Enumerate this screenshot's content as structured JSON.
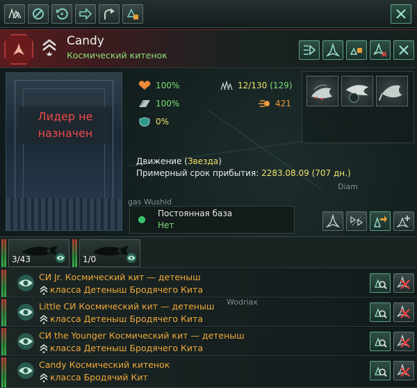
{
  "toolbar": {
    "buttons": [
      {
        "icon": "fleet-formation-icon"
      },
      {
        "icon": "stop-icon"
      },
      {
        "icon": "return-icon"
      },
      {
        "icon": "move-arrow-icon"
      },
      {
        "icon": "retreat-icon"
      },
      {
        "icon": "fleet-lock-icon"
      }
    ],
    "close_icon": "close-icon"
  },
  "header": {
    "fleet_name": "Candy",
    "fleet_class": "Космический китенок",
    "actions": [
      "fleet-play-icon",
      "ship-icon",
      "lock-ship-icon",
      "ship-remove-icon",
      "close-icon"
    ]
  },
  "leader": {
    "text": "Лидер не назначен"
  },
  "stats": {
    "hull": "100%",
    "armor": "100%",
    "shield": "0%",
    "naval_capacity": "12/130",
    "naval_capacity_extra": "(129)",
    "fleet_power": "421"
  },
  "movement": {
    "label": "Движение",
    "status": "Звезда",
    "eta_label": "Примерный срок прибытия:",
    "eta_date": "2283.08.09",
    "eta_days": "(707 дн.)"
  },
  "home_base": {
    "label": "Постоянная база",
    "value": "Нет"
  },
  "map_labels": [
    "Diam",
    "Wodriax",
    "gas Wushid"
  ],
  "counters": [
    {
      "value": "3/43"
    },
    {
      "value": "1/0"
    }
  ],
  "ships": [
    {
      "name": "СИ  Jr. Космический кит — детеныш",
      "class": "класса Детеныш Бродячего Кита"
    },
    {
      "name": "Little СИ  Космический кит — детеныш",
      "class": "класса Детеныш Бродячего Кита"
    },
    {
      "name": "СИ  the Younger Космический кит — детеныш",
      "class": "класса Детеныш Бродячего Кита"
    },
    {
      "name": "Candy Космический китенок",
      "class": "класса Бродячий Кит"
    }
  ],
  "colors": {
    "accent_green": "#7fe07a",
    "accent_orange": "#f1a93a",
    "warn_red": "#ef4a48",
    "header_red": "#5a1c1f"
  }
}
